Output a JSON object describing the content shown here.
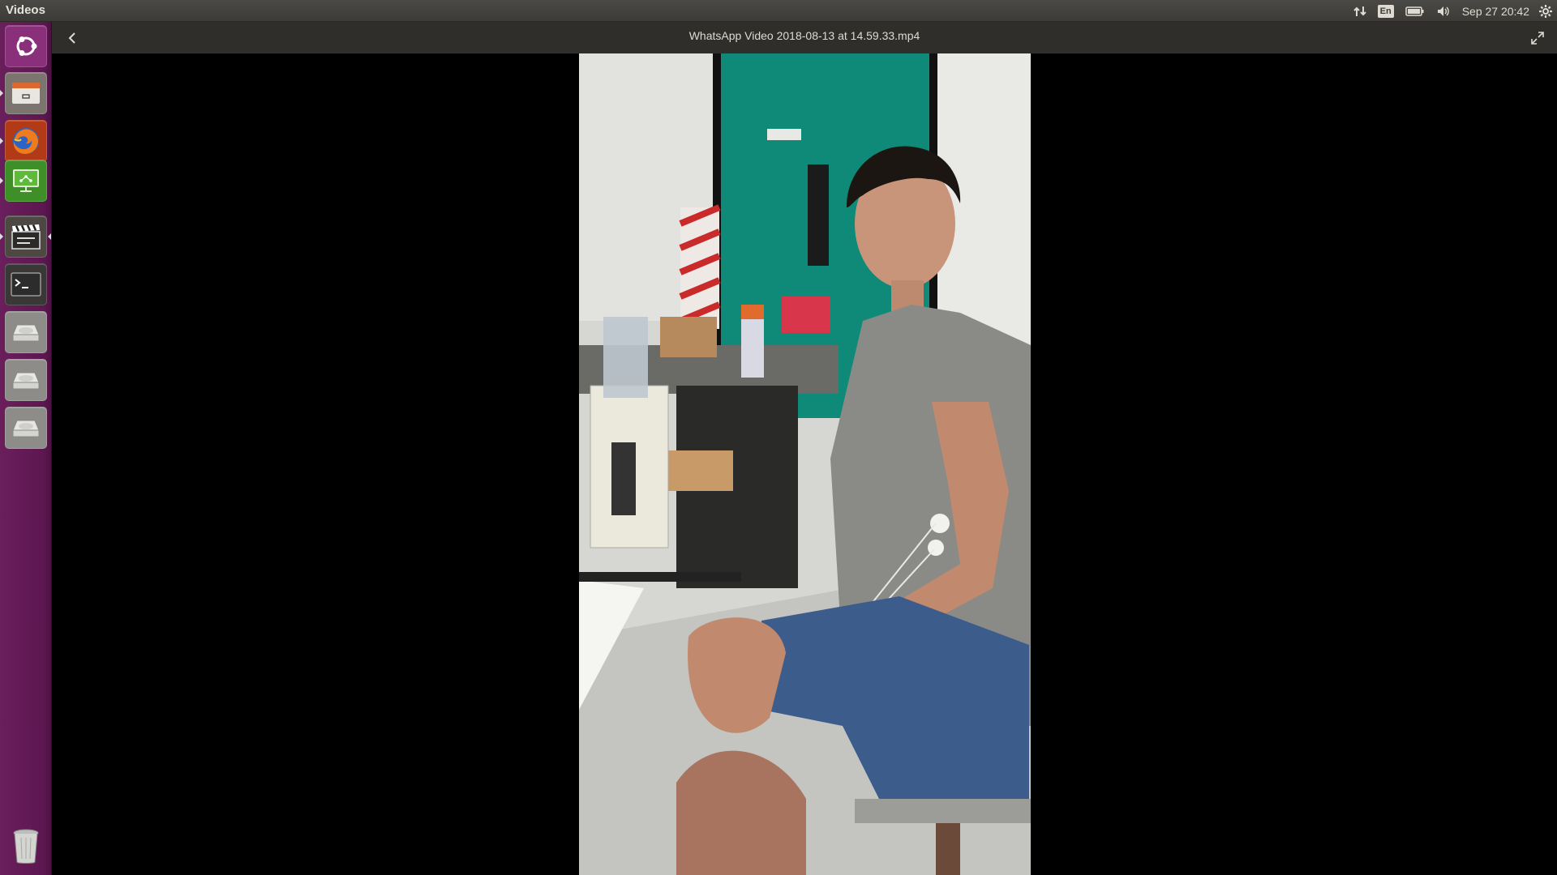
{
  "panel": {
    "app_title": "Videos",
    "language": "En",
    "clock": "Sep 27 20:42",
    "icons": [
      "network-icon",
      "keyboard-language-icon",
      "battery-icon",
      "volume-icon",
      "settings-gear-icon"
    ]
  },
  "launcher": {
    "items": [
      {
        "name": "ubuntu-dash-icon",
        "color": "#8a2f7a"
      },
      {
        "name": "files-icon",
        "color": "#8d8680"
      },
      {
        "name": "firefox-icon",
        "color": "#e86c19"
      },
      {
        "name": "remote-desktop-icon",
        "color": "#4a9a2e"
      },
      {
        "name": "videos-clapperboard-icon",
        "color": "#5f5a55"
      },
      {
        "name": "terminal-icon",
        "color": "#2c2c2c"
      },
      {
        "name": "drive-icon",
        "color": "#b5b5b0"
      },
      {
        "name": "drive-icon",
        "color": "#b5b5b0"
      },
      {
        "name": "drive-icon",
        "color": "#b5b5b0"
      },
      {
        "name": "trash-icon",
        "color": "#8a8a85"
      }
    ]
  },
  "header": {
    "back_icon": "chevron-left-icon",
    "title": "WhatsApp Video 2018-08-13 at 14.59.33.mp4",
    "fullscreen_icon": "fullscreen-icon"
  },
  "video": {
    "description_icon": "video-frame"
  }
}
